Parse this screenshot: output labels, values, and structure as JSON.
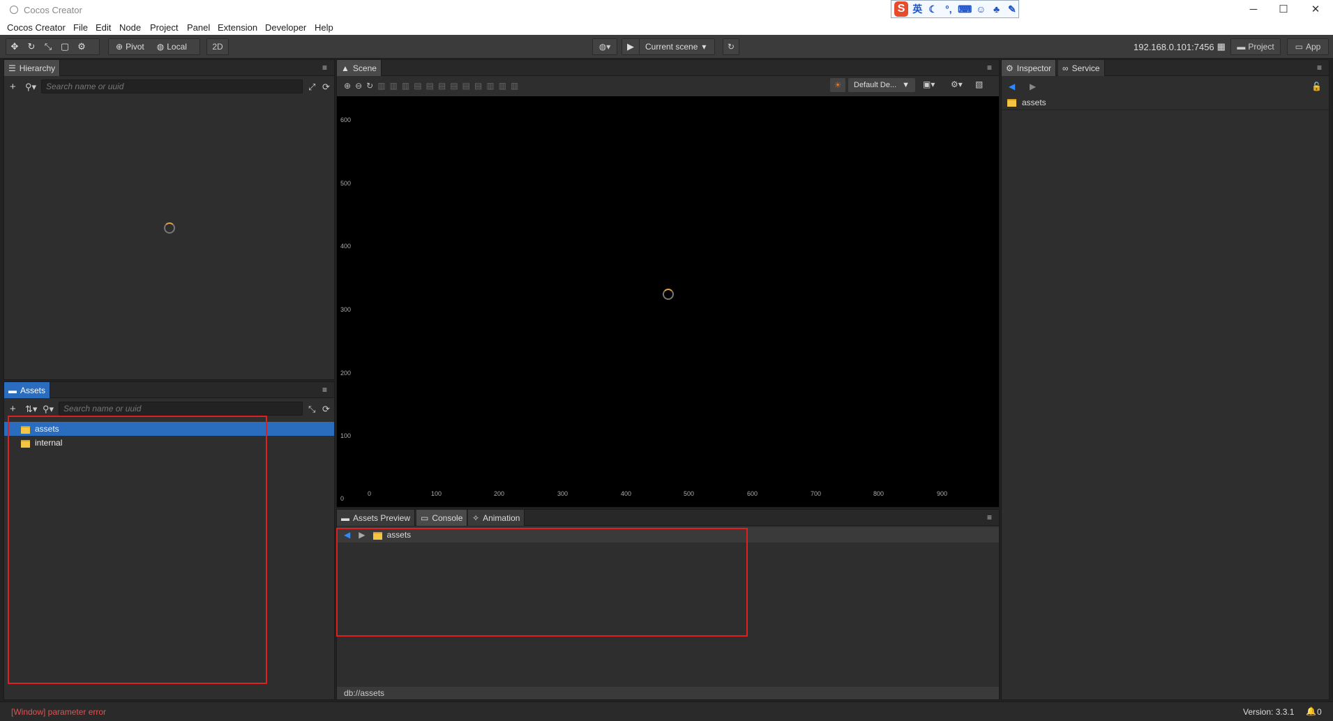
{
  "window": {
    "title": "Cocos Creator"
  },
  "menu": [
    "Cocos Creator",
    "File",
    "Edit",
    "Node",
    "Project",
    "Panel",
    "Extension",
    "Developer",
    "Help"
  ],
  "ime": {
    "label": "英",
    "icons": [
      "moon-icon",
      "punct-icon",
      "keyboard-icon",
      "user-icon",
      "shirt-icon",
      "wrench-icon"
    ]
  },
  "toolbar": {
    "pivot": "Pivot",
    "local": "Local",
    "mode2d": "2D",
    "scene_select": "Current scene",
    "ip": "192.168.0.101:7456",
    "project": "Project",
    "app": "App"
  },
  "hierarchy": {
    "tab": "Hierarchy",
    "search_placeholder": "Search name or uuid"
  },
  "assets": {
    "tab": "Assets",
    "search_placeholder": "Search name or uuid",
    "items": [
      {
        "label": "assets",
        "selected": true
      },
      {
        "label": "internal",
        "selected": false
      }
    ]
  },
  "scene": {
    "tab": "Scene",
    "design": "Default De...",
    "y_ticks": [
      "600",
      "500",
      "400",
      "300",
      "200",
      "100",
      "0"
    ],
    "x_ticks": [
      "0",
      "100",
      "200",
      "300",
      "400",
      "500",
      "600",
      "700",
      "800",
      "900"
    ]
  },
  "bottom": {
    "tabs": [
      "Assets Preview",
      "Console",
      "Animation"
    ],
    "breadcrumb": "assets",
    "path": "db://assets"
  },
  "inspector": {
    "tabs": [
      "Inspector",
      "Service"
    ],
    "item": "assets"
  },
  "status": {
    "error": "[Window] parameter error",
    "version": "Version: 3.3.1",
    "notifications": "0"
  },
  "colors": {
    "accent": "#2a6dbf",
    "error": "#e05252",
    "highlight": "#e02020"
  }
}
